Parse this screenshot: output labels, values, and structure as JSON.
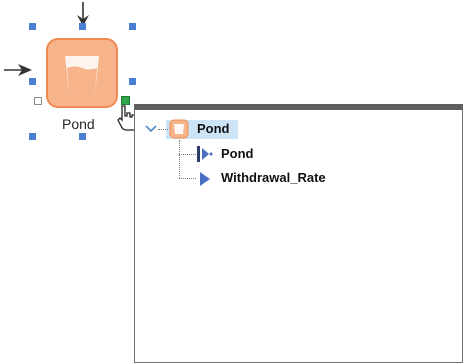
{
  "node": {
    "label": "Pond",
    "icon": "stock-bucket-icon",
    "fill_color": "#f7b48a",
    "border_color": "#ef8b52"
  },
  "tree": {
    "root": {
      "label": "Pond",
      "icon": "stock-bucket-icon"
    },
    "children": [
      {
        "label": "Pond",
        "icon": "link-arrow-icon"
      },
      {
        "label": "Withdrawal_Rate",
        "icon": "flow-arrow-icon"
      }
    ]
  }
}
